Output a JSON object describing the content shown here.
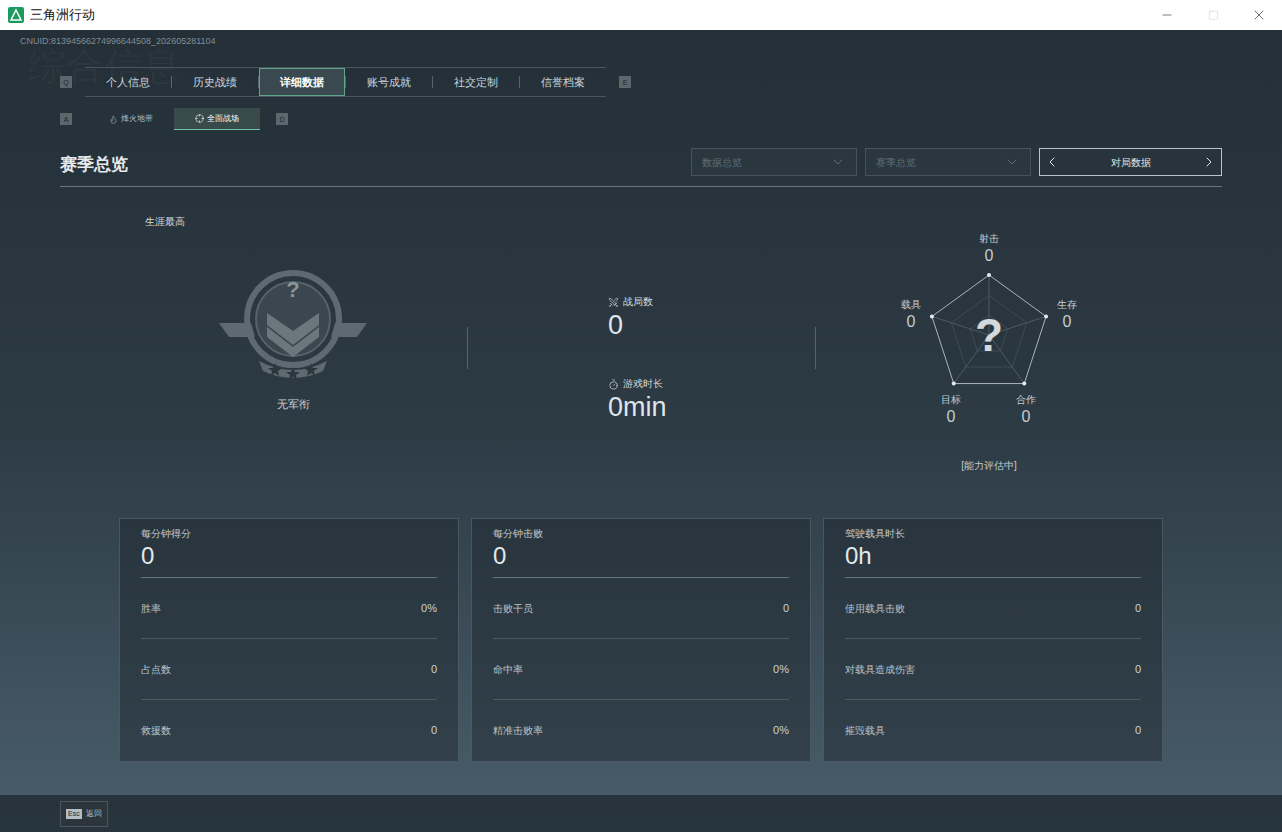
{
  "window": {
    "title": "三角洲行动",
    "controls": [
      {
        "kind": "minimize",
        "disabled": false
      },
      {
        "kind": "maximize",
        "disabled": true
      },
      {
        "kind": "close",
        "disabled": false
      }
    ]
  },
  "player_id": "CNUID:81394566274996644508_202605281104",
  "watermark": "综合信息",
  "tabs": {
    "prev_key": "Q",
    "next_key": "E",
    "items": [
      {
        "label": "个人信息",
        "selected": false
      },
      {
        "label": "历史战绩",
        "selected": false
      },
      {
        "label": "详细数据",
        "selected": true
      },
      {
        "label": "账号成就",
        "selected": false
      },
      {
        "label": "社交定制",
        "selected": false
      },
      {
        "label": "信誉档案",
        "selected": false
      }
    ]
  },
  "mode_tabs": {
    "prev_key": "A",
    "next_key": "D",
    "items": [
      {
        "label": "烽火地带",
        "selected": false,
        "kind": "extraction"
      },
      {
        "label": "全面战场",
        "selected": true,
        "kind": "warfare"
      }
    ]
  },
  "section_title": "赛季总览",
  "filters": [
    {
      "label": "数据总览",
      "disabled": true
    },
    {
      "label": "赛季总览",
      "disabled": true
    }
  ],
  "stat_selector": {
    "label": "对局数据"
  },
  "rank": {
    "caption": "生涯最高",
    "badge": "?",
    "name": "无军衔"
  },
  "overview": [
    {
      "label": "战局数",
      "value": "0",
      "kind": "matches"
    },
    {
      "label": "游戏时长",
      "value": "0min",
      "kind": "time"
    }
  ],
  "radar": {
    "center": "?",
    "status": "[能力评估中]",
    "axes": [
      {
        "label": "射击",
        "value": "0",
        "level": 0
      },
      {
        "label": "生存",
        "value": "0",
        "level": 0
      },
      {
        "label": "合作",
        "value": "0",
        "level": 0
      },
      {
        "label": "目标",
        "value": "0",
        "level": 0
      },
      {
        "label": "载具",
        "value": "0",
        "level": 0
      }
    ]
  },
  "cards": [
    {
      "title": "每分钟得分",
      "value": "0",
      "rows": [
        {
          "label": "胜率",
          "value": "0%"
        },
        {
          "label": "占点数",
          "value": "0"
        },
        {
          "label": "救援数",
          "value": "0"
        }
      ]
    },
    {
      "title": "每分钟击败",
      "value": "0",
      "rows": [
        {
          "label": "击败干员",
          "value": "0"
        },
        {
          "label": "命中率",
          "value": "0%"
        },
        {
          "label": "精准击败率",
          "value": "0%"
        }
      ]
    },
    {
      "title": "驾驶载具时长",
      "value": "0h",
      "rows": [
        {
          "label": "使用载具击败",
          "value": "0"
        },
        {
          "label": "对载具造成伤害",
          "value": "0"
        },
        {
          "label": "摧毁载具",
          "value": "0"
        }
      ]
    }
  ],
  "footer": {
    "key": "Esc",
    "label": "返回"
  }
}
